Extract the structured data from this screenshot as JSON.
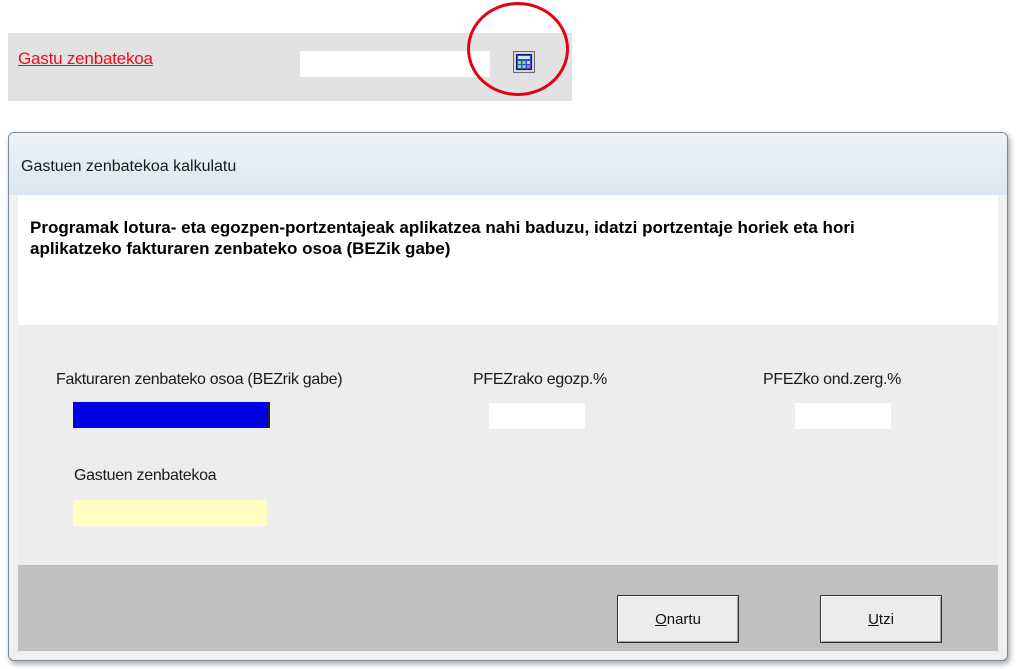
{
  "top_field": {
    "label": "Gastu zenbatekoa",
    "value": "",
    "calc_icon": "calculator-icon"
  },
  "dialog": {
    "title": "Gastuen zenbatekoa kalkulatu",
    "instructions": "Programak lotura- eta egozpen-portzentajeak aplikatzea nahi baduzu, idatzi portzentaje horiek eta hori aplikatzeko fakturaren zenbateko osoa (BEZik gabe)",
    "fields": {
      "invoice_total_label": "Fakturaren zenbateko osoa (BEZrik gabe)",
      "invoice_total_value": "",
      "withholding_label": "PFEZrako egozp.%",
      "withholding_value": "",
      "tax_rate_label": "PFEZko ond.zerg.%",
      "tax_rate_value": "",
      "expense_amount_label": "Gastuen zenbatekoa",
      "expense_amount_value": ""
    },
    "buttons": {
      "accept_mnemonic": "O",
      "accept_rest": "nartu",
      "cancel_mnemonic": "U",
      "cancel_rest": "tzi"
    }
  },
  "colors": {
    "link_red": "#e8101a",
    "highlight_circle": "#e50012",
    "invoice_field_selected": "#0000e6",
    "expense_field_readonly": "#ffffc2"
  }
}
